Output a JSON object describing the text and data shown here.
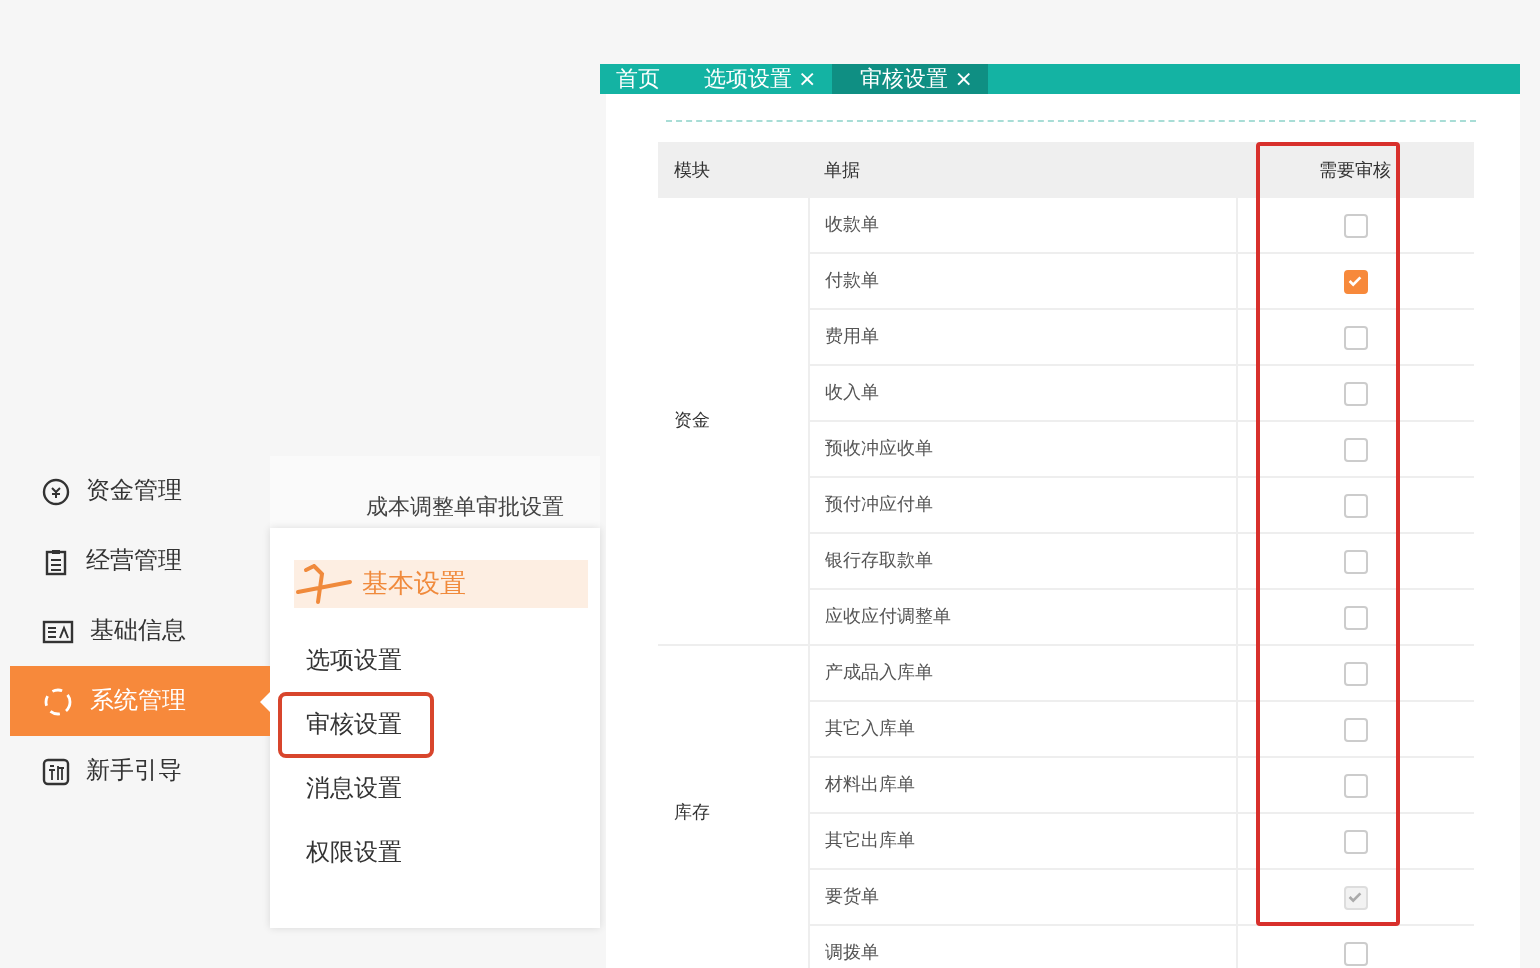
{
  "sidebar": {
    "items": [
      {
        "label": "资金管理",
        "selected": false
      },
      {
        "label": "经营管理",
        "selected": false
      },
      {
        "label": "基础信息",
        "selected": false
      },
      {
        "label": "系统管理",
        "selected": true
      },
      {
        "label": "新手引导",
        "selected": false
      }
    ]
  },
  "submenu": {
    "top_link": "成本调整单审批设置",
    "group_title": "基本设置",
    "items": [
      {
        "label": "选项设置",
        "annotated": false
      },
      {
        "label": "审核设置",
        "annotated": true
      },
      {
        "label": "消息设置",
        "annotated": false
      },
      {
        "label": "权限设置",
        "annotated": false
      }
    ]
  },
  "tabs": [
    {
      "label": "首页",
      "closable": false,
      "selected": false
    },
    {
      "label": "选项设置",
      "closable": true,
      "selected": false
    },
    {
      "label": "审核设置",
      "closable": true,
      "selected": true
    }
  ],
  "close_glyph": "×",
  "table": {
    "columns": [
      "模块",
      "单据",
      "需要审核"
    ],
    "check_column_annotated": true,
    "groups": [
      {
        "module": "资金",
        "rows": [
          {
            "document": "收款单",
            "checked": false,
            "disabled": false
          },
          {
            "document": "付款单",
            "checked": true,
            "disabled": false
          },
          {
            "document": "费用单",
            "checked": false,
            "disabled": false
          },
          {
            "document": "收入单",
            "checked": false,
            "disabled": false
          },
          {
            "document": "预收冲应收单",
            "checked": false,
            "disabled": false
          },
          {
            "document": "预付冲应付单",
            "checked": false,
            "disabled": false
          },
          {
            "document": "银行存取款单",
            "checked": false,
            "disabled": false
          },
          {
            "document": "应收应付调整单",
            "checked": false,
            "disabled": false
          }
        ]
      },
      {
        "module": "库存",
        "rows": [
          {
            "document": "产成品入库单",
            "checked": false,
            "disabled": false
          },
          {
            "document": "其它入库单",
            "checked": false,
            "disabled": false
          },
          {
            "document": "材料出库单",
            "checked": false,
            "disabled": false
          },
          {
            "document": "其它出库单",
            "checked": false,
            "disabled": false
          },
          {
            "document": "要货单",
            "checked": true,
            "disabled": true
          },
          {
            "document": "调拨单",
            "checked": false,
            "disabled": false
          }
        ]
      }
    ]
  }
}
